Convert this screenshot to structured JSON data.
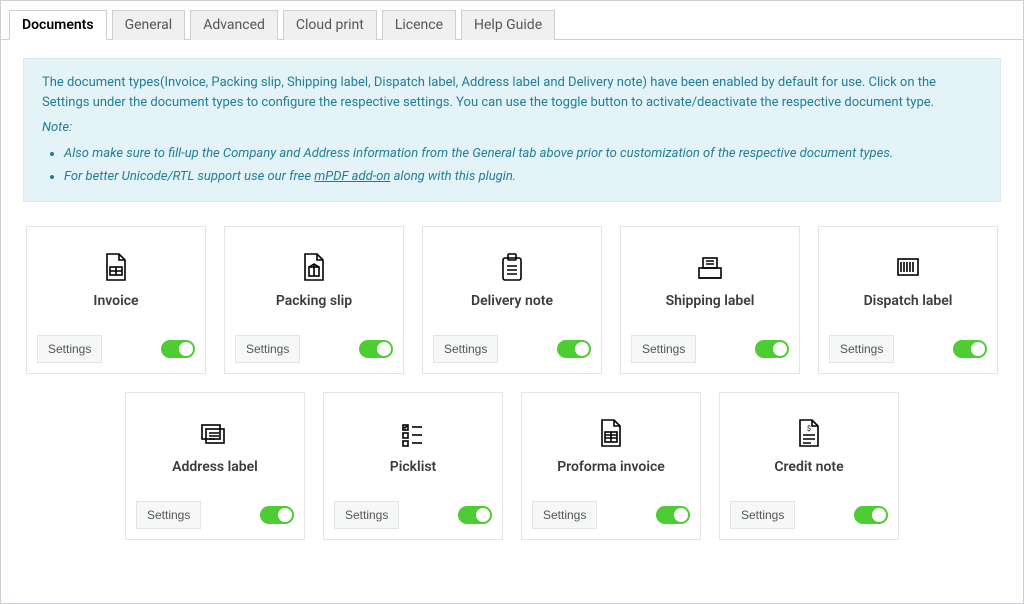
{
  "tabs": {
    "items": [
      {
        "label": "Documents",
        "active": true
      },
      {
        "label": "General"
      },
      {
        "label": "Advanced"
      },
      {
        "label": "Cloud print"
      },
      {
        "label": "Licence"
      },
      {
        "label": "Help Guide"
      }
    ]
  },
  "notice": {
    "intro": "The document types(Invoice, Packing slip, Shipping label, Dispatch label, Address label and Delivery note) have been enabled by default for use. Click on the Settings under the document types to configure the respective settings. You can use the toggle button to activate/deactivate the respective document type.",
    "note_heading": "Note:",
    "bullets": [
      "Also make sure to fill-up the Company and Address information from the General tab above prior to customization of the respective document types.",
      "For better Unicode/RTL support use our free "
    ],
    "addon_link": "mPDF add-on",
    "bullet2_tail": " along with this plugin."
  },
  "settings_label": "Settings",
  "cards_row1": [
    {
      "name": "invoice",
      "label": "Invoice",
      "enabled": true
    },
    {
      "name": "packing-slip",
      "label": "Packing slip",
      "enabled": true
    },
    {
      "name": "delivery-note",
      "label": "Delivery note",
      "enabled": true
    },
    {
      "name": "shipping-label",
      "label": "Shipping label",
      "enabled": true
    },
    {
      "name": "dispatch-label",
      "label": "Dispatch label",
      "enabled": true
    }
  ],
  "cards_row2": [
    {
      "name": "address-label",
      "label": "Address label",
      "enabled": true
    },
    {
      "name": "picklist",
      "label": "Picklist",
      "enabled": true
    },
    {
      "name": "proforma-invoice",
      "label": "Proforma invoice",
      "enabled": true
    },
    {
      "name": "credit-note",
      "label": "Credit note",
      "enabled": true
    }
  ]
}
